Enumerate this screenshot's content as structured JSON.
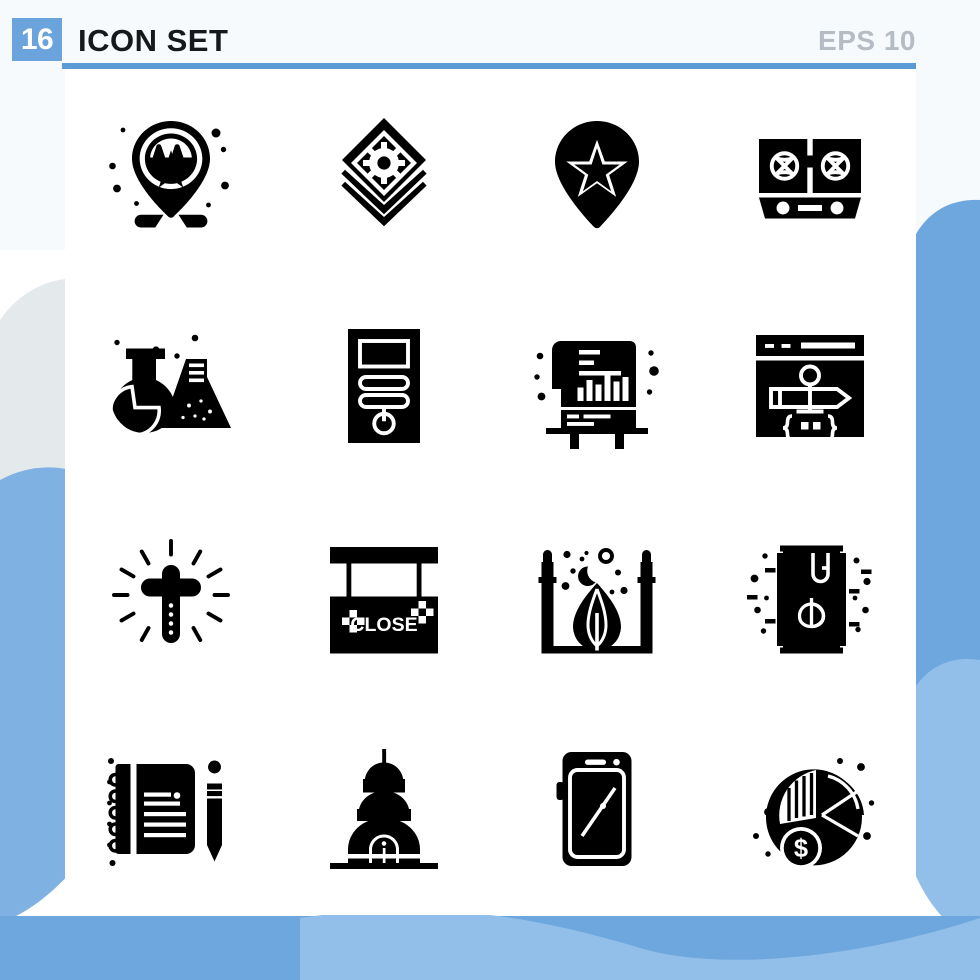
{
  "header": {
    "count_badge": "16",
    "title": "ICON SET",
    "eps_label": "EPS 10",
    "badge_color": "#6ba3dc",
    "rule_color": "#5b9bd5",
    "title_color": "#17181a",
    "eps_color": "#b6bcc4"
  },
  "panel": {
    "background": "#ffffff",
    "icon_color": "#000000",
    "rows": 4,
    "columns": 4,
    "total_icons": 16
  },
  "background": {
    "page_color": "#ffffff",
    "blob_gray": "#e4e9ec",
    "blob_blue_dark": "#6ea7dd",
    "blob_blue_light": "#92bfe9",
    "blob_blue_mid": "#7fb2e3",
    "tint_top": "#f7fafd"
  },
  "icons": [
    {
      "index": 1,
      "name": "map-pin-star-badge-icon",
      "label": "Favourite Location Pin"
    },
    {
      "index": 2,
      "name": "layers-gear-icon",
      "label": "Layer Settings"
    },
    {
      "index": 3,
      "name": "map-pin-star-icon",
      "label": "Star Location Pin"
    },
    {
      "index": 4,
      "name": "gas-stove-icon",
      "label": "Gas Stove"
    },
    {
      "index": 5,
      "name": "lab-flasks-icon",
      "label": "Laboratory Flasks"
    },
    {
      "index": 6,
      "name": "computer-tower-icon",
      "label": "Computer Tower"
    },
    {
      "index": 7,
      "name": "presentation-chart-icon",
      "label": "Presentation Board Chart"
    },
    {
      "index": 8,
      "name": "web-design-browser-icon",
      "label": "Web Design Browser"
    },
    {
      "index": 9,
      "name": "glowing-cross-icon",
      "label": "Glowing Cross"
    },
    {
      "index": 10,
      "name": "close-sign-icon",
      "label": "Close Sign",
      "sign_text": "CLOSE"
    },
    {
      "index": 11,
      "name": "mosque-icon",
      "label": "Mosque"
    },
    {
      "index": 12,
      "name": "biofuel-barrel-leaf-icon",
      "label": "Biofuel Barrel"
    },
    {
      "index": 13,
      "name": "notebook-pencil-icon",
      "label": "Notebook and Pencil"
    },
    {
      "index": 14,
      "name": "capitol-monument-icon",
      "label": "Capitol Monument"
    },
    {
      "index": 15,
      "name": "smartphone-icon",
      "label": "Smartphone"
    },
    {
      "index": 16,
      "name": "pie-chart-dollar-icon",
      "label": "Financial Pie Chart"
    }
  ]
}
